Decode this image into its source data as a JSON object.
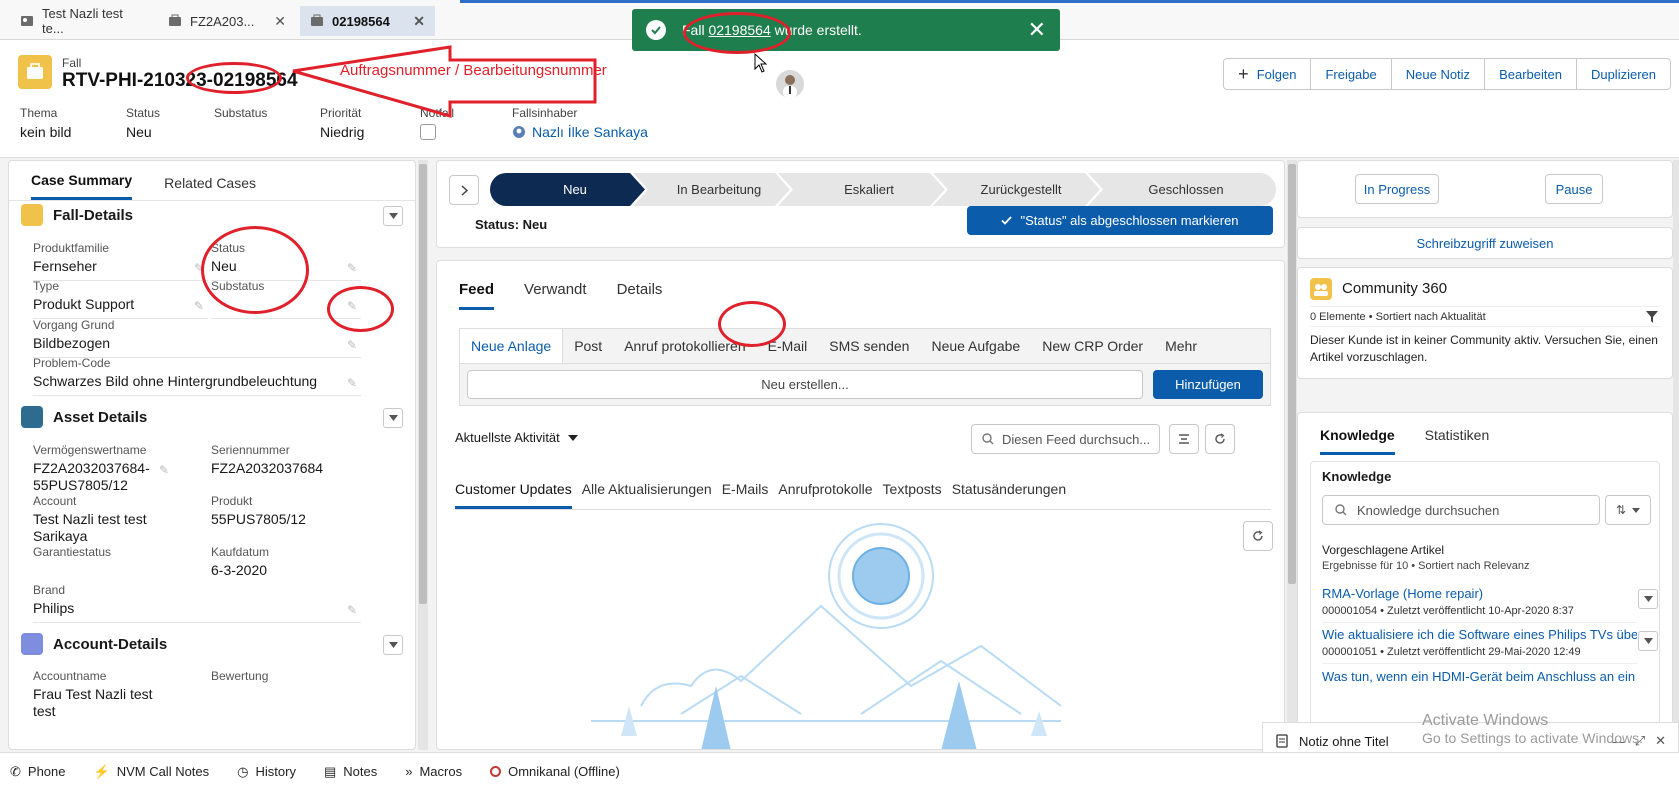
{
  "tabs": [
    {
      "label": "Test Nazli test te...",
      "icon": "account-icon"
    },
    {
      "label": "FZ2A203...",
      "icon": "case-icon"
    },
    {
      "label": "02198564",
      "icon": "case-icon"
    }
  ],
  "toast": {
    "prefix": "Fall",
    "link": "02198564",
    "suffix": "wurde erstellt."
  },
  "record": {
    "type_label": "Fall",
    "title": "RTV-PHI-210323-02198564",
    "buttons": [
      "Folgen",
      "Freigabe",
      "Neue Notiz",
      "Bearbeiten",
      "Duplizieren"
    ],
    "fields": {
      "thema_label": "Thema",
      "thema_value": "kein bild",
      "status_label": "Status",
      "status_value": "Neu",
      "substatus_label": "Substatus",
      "prio_label": "Priorität",
      "prio_value": "Niedrig",
      "notfall_label": "Notfall",
      "owner_label": "Fallsinhaber",
      "owner_value": "Nazlı İlke Sankaya"
    }
  },
  "annotation": {
    "text": "Auftragsnummer / Bearbeitungsnummer"
  },
  "left": {
    "tabs": [
      "Case Summary",
      "Related Cases"
    ],
    "sections": {
      "fall": "Fall-Details",
      "asset": "Asset Details",
      "account": "Account-Details"
    },
    "fall_fields": {
      "produktfamilie_l": "Produktfamilie",
      "produktfamilie_v": "Fernseher",
      "status_l": "Status",
      "status_v": "Neu",
      "type_l": "Type",
      "type_v": "Produkt Support",
      "substatus_l": "Substatus",
      "vorgang_l": "Vorgang Grund",
      "vorgang_v": "Bildbezogen",
      "problem_l": "Problem-Code",
      "problem_v": "Schwarzes Bild ohne Hintergrundbeleuchtung"
    },
    "asset_fields": {
      "vermoegen_l": "Vermögenswertname",
      "vermoegen_v": "FZ2A2032037684-55PUS7805/12",
      "serie_l": "Seriennummer",
      "serie_v": "FZ2A2032037684",
      "account_l": "Account",
      "account_v": "Test Nazli test test Sarikaya",
      "produkt_l": "Produkt",
      "produkt_v": "55PUS7805/12",
      "garantie_l": "Garantiestatus",
      "kauf_l": "Kaufdatum",
      "kauf_v": "6-3-2020",
      "brand_l": "Brand",
      "brand_v": "Philips"
    },
    "account_fields": {
      "name_l": "Accountname",
      "name_v": "Frau Test Nazli test test",
      "bewertung_l": "Bewertung"
    }
  },
  "path": {
    "stages": [
      "Neu",
      "In Bearbeitung",
      "Eskaliert",
      "Zurückgestellt",
      "Geschlossen"
    ],
    "status_text": "Status: Neu",
    "complete_button": "\"Status\" als abgeschlossen markieren"
  },
  "feed": {
    "tabs": [
      "Feed",
      "Verwandt",
      "Details"
    ],
    "publisher": [
      "Neue Anlage",
      "Post",
      "Anruf protokollieren",
      "E-Mail",
      "SMS senden",
      "Neue Aufgabe",
      "New CRP Order",
      "Mehr"
    ],
    "new_placeholder": "Neu erstellen...",
    "add_button": "Hinzufügen",
    "sort_label": "Aktuellste Aktivität",
    "search_placeholder": "Diesen Feed durchsuch...",
    "filters": [
      "Customer Updates",
      "Alle Aktualisierungen",
      "E-Mails",
      "Anrufprotokolle",
      "Textposts",
      "Statusänderungen"
    ]
  },
  "right": {
    "in_progress": "In Progress",
    "pause": "Pause",
    "assign": "Schreibzugriff zuweisen",
    "community_title": "Community 360",
    "community_meta": "0 Elemente • Sortiert nach Aktualität",
    "community_text": "Dieser Kunde ist in keiner Community aktiv. Versuchen Sie, einen Artikel vorzuschlagen.",
    "k_tabs": [
      "Knowledge",
      "Statistiken"
    ],
    "k_title": "Knowledge",
    "k_search": "Knowledge durchsuchen",
    "k_suggested": "Vorgeschlagene Artikel",
    "k_results": "Ergebnisse für 10 • Sortiert nach Relevanz",
    "articles": [
      {
        "title": "RMA-Vorlage (Home repair)",
        "meta": "000001054  •  Zuletzt veröffentlicht  10-Apr-2020 8:37"
      },
      {
        "title": "Wie aktualisiere ich die Software eines Philips TVs über USB?",
        "meta": "000001051  •  Zuletzt veröffentlicht  29-Mai-2020 12:49"
      },
      {
        "title": "Was tun, wenn ein HDMI-Gerät beim Anschluss an ein Phil...",
        "meta": ""
      }
    ]
  },
  "utility": {
    "note": "Notiz ohne Titel"
  },
  "watermark": {
    "line1": "Activate Windows",
    "line2": "Go to Settings to activate Windows."
  },
  "footer": [
    "Phone",
    "NVM Call Notes",
    "History",
    "Notes",
    "Macros",
    "Omnikanal (Offline)"
  ]
}
